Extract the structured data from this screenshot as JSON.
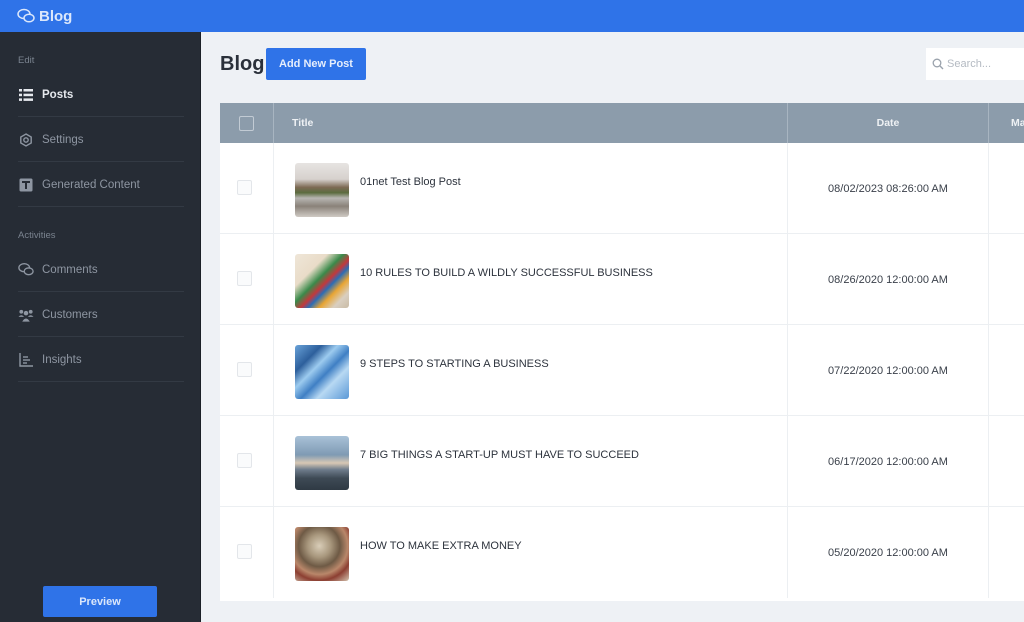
{
  "app": {
    "title": "Blog",
    "icon": "chat-bubbles-icon"
  },
  "sidebar": {
    "sections": [
      {
        "label": "Edit"
      },
      {
        "label": "Activities"
      }
    ],
    "items": [
      {
        "label": "Posts",
        "icon": "list-icon",
        "active": true
      },
      {
        "label": "Settings",
        "icon": "gear-icon",
        "active": false
      },
      {
        "label": "Generated Content",
        "icon": "calendar-icon",
        "active": false
      },
      {
        "label": "Comments",
        "icon": "chat-bubbles-icon",
        "active": false
      },
      {
        "label": "Customers",
        "icon": "users-icon",
        "active": false
      },
      {
        "label": "Insights",
        "icon": "chart-icon",
        "active": false
      }
    ],
    "preview_label": "Preview"
  },
  "main": {
    "title": "Blog",
    "add_button_label": "Add New Post",
    "search": {
      "placeholder": "Search...",
      "value": ""
    },
    "table": {
      "columns": [
        "",
        "Title",
        "Date",
        "Ma"
      ],
      "rows": [
        {
          "title": "01net Test Blog Post",
          "date": "08/02/2023 08:26:00 AM",
          "thumbnail": "lake-mountains"
        },
        {
          "title": "10 RULES TO BUILD A WILDLY SUCCESSFUL BUSINESS",
          "date": "08/26/2020 12:00:00 AM",
          "thumbnail": "colorful-blocks"
        },
        {
          "title": "9 STEPS TO STARTING A BUSINESS",
          "date": "07/22/2020 12:00:00 AM",
          "thumbnail": "blue-abstract"
        },
        {
          "title": "7 BIG THINGS A START-UP MUST HAVE TO SUCCEED",
          "date": "06/17/2020 12:00:00 AM",
          "thumbnail": "person-on-cliff"
        },
        {
          "title": "HOW TO MAKE EXTRA MONEY",
          "date": "05/20/2020 12:00:00 AM",
          "thumbnail": "coins-jar"
        }
      ]
    }
  },
  "colors": {
    "accent": "#2f73e8",
    "sidebar_bg": "#262c35",
    "table_header_bg": "#8c9cab",
    "page_bg": "#eef1f5"
  }
}
